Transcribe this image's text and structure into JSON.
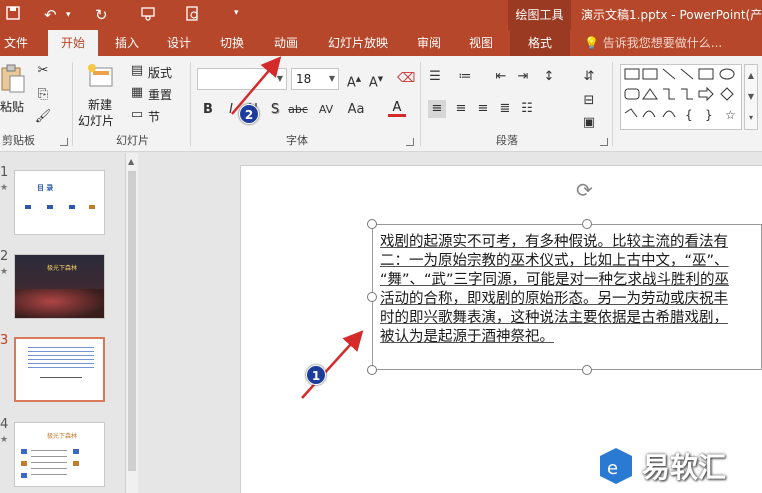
{
  "titlebar": {
    "context_group": "绘图工具",
    "doc_title": "演示文稿1.pptx - PowerPoint(产品"
  },
  "tabs": [
    {
      "label": "文件"
    },
    {
      "label": "开始"
    },
    {
      "label": "插入"
    },
    {
      "label": "设计"
    },
    {
      "label": "切换"
    },
    {
      "label": "动画"
    },
    {
      "label": "幻灯片放映"
    },
    {
      "label": "审阅"
    },
    {
      "label": "视图"
    },
    {
      "label": "格式"
    }
  ],
  "tell_me": "告诉我您想要做什么...",
  "ribbon": {
    "clipboard": {
      "paste": "粘贴",
      "group": "剪贴板"
    },
    "slides": {
      "new_slide_1": "新建",
      "new_slide_2": "幻灯片",
      "layout": "版式",
      "reset": "重置",
      "section": "节",
      "group": "幻灯片"
    },
    "font": {
      "font_name": "",
      "font_size": "18",
      "group": "字体",
      "bold": "B",
      "italic": "I",
      "underline": "U",
      "shadow": "S",
      "strike": "abc",
      "spacing": "AV",
      "case": "Aa",
      "color": "A"
    },
    "paragraph": {
      "group": "段落"
    }
  },
  "slides_panel": [
    {
      "num": "1",
      "title": "目    录"
    },
    {
      "num": "2",
      "title": "极光下森林"
    },
    {
      "num": "3",
      "title": ""
    },
    {
      "num": "4",
      "title": "极光下森林"
    }
  ],
  "slide_text": [
    "戏剧的起源实不可考，有多种假说。比较主流的看法有",
    "二：一为原始宗教的巫术仪式，比如上古中文，“巫”、",
    "“舞”、“武”三字同源，可能是对一种乞求战斗胜利的巫",
    "活动的合称，即戏剧的原始形态。另一为劳动或庆祝丰",
    "时的即兴歌舞表演，这种说法主要依据是古希腊戏剧，",
    "被认为是起源于酒神祭祀。"
  ],
  "annotations": {
    "badge1": "1",
    "badge2": "2",
    "arrow_color": "#d42a2a"
  },
  "watermark": {
    "text": "易软汇"
  }
}
